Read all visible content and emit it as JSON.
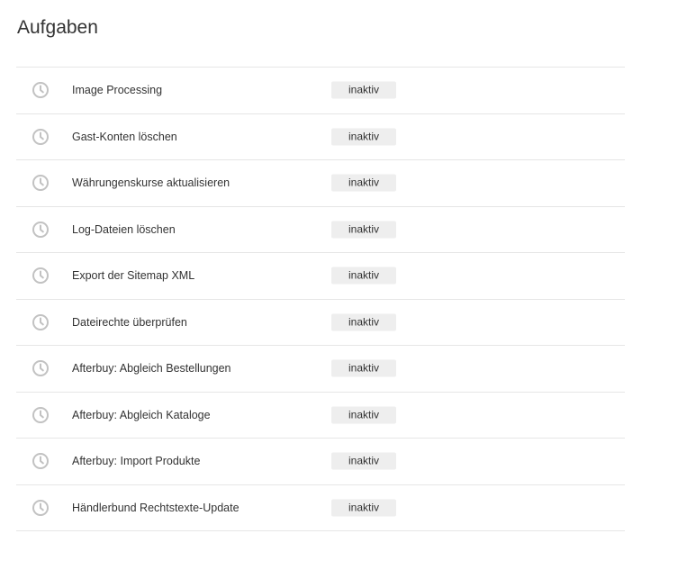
{
  "page": {
    "title": "Aufgaben"
  },
  "colors": {
    "icon": "#c2c2c2",
    "badge_bg": "#eeeeee",
    "divider": "#e6e6e6",
    "text": "#333333"
  },
  "tasks": [
    {
      "icon": "clock-icon",
      "name": "Image Processing",
      "status": "inaktiv"
    },
    {
      "icon": "clock-icon",
      "name": "Gast-Konten löschen",
      "status": "inaktiv"
    },
    {
      "icon": "clock-icon",
      "name": "Währungenskurse aktualisieren",
      "status": "inaktiv"
    },
    {
      "icon": "clock-icon",
      "name": "Log-Dateien löschen",
      "status": "inaktiv"
    },
    {
      "icon": "clock-icon",
      "name": "Export der Sitemap XML",
      "status": "inaktiv"
    },
    {
      "icon": "clock-icon",
      "name": "Dateirechte überprüfen",
      "status": "inaktiv"
    },
    {
      "icon": "clock-icon",
      "name": "Afterbuy: Abgleich Bestellungen",
      "status": "inaktiv"
    },
    {
      "icon": "clock-icon",
      "name": "Afterbuy: Abgleich Kataloge",
      "status": "inaktiv"
    },
    {
      "icon": "clock-icon",
      "name": "Afterbuy: Import Produkte",
      "status": "inaktiv"
    },
    {
      "icon": "clock-icon",
      "name": "Händlerbund Rechtstexte-Update",
      "status": "inaktiv"
    }
  ]
}
